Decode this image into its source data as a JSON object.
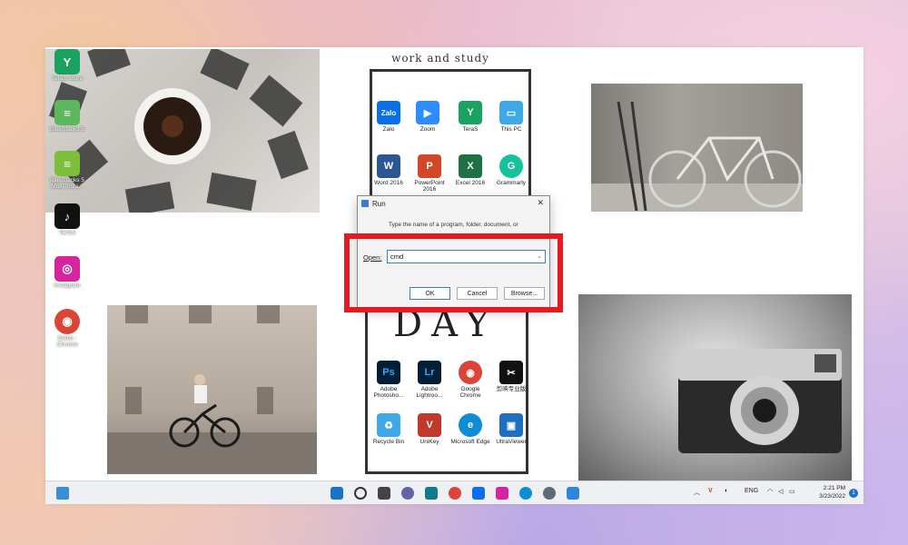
{
  "board": {
    "title": "work and study",
    "big_word": "DAY",
    "top_apps": [
      {
        "label": "Zalo",
        "icon": "zalo-icon",
        "color": "#0a6fe8",
        "glyph": "Zalo"
      },
      {
        "label": "Zoom",
        "icon": "zoom-icon",
        "color": "#2d8cff",
        "glyph": "▶"
      },
      {
        "label": "TeraS",
        "icon": "teras-icon",
        "color": "#1aa260",
        "glyph": "Y"
      },
      {
        "label": "This PC",
        "icon": "this-pc-icon",
        "color": "#3fa9e8",
        "glyph": "▭"
      },
      {
        "label": "Word 2016",
        "icon": "word-icon",
        "color": "#2b5797",
        "glyph": "W"
      },
      {
        "label": "PowerPoint 2016",
        "icon": "powerpoint-icon",
        "color": "#d24726",
        "glyph": "P"
      },
      {
        "label": "Excel 2016",
        "icon": "excel-icon",
        "color": "#1e7145",
        "glyph": "X"
      },
      {
        "label": "Grammarly",
        "icon": "grammarly-icon",
        "color": "#15c39a",
        "glyph": "G"
      }
    ],
    "bottom_apps": [
      {
        "label": "Adobe Photosho...",
        "icon": "photoshop-icon",
        "color": "#001e36",
        "glyph": "Ps"
      },
      {
        "label": "Adobe Lightroo...",
        "icon": "lightroom-icon",
        "color": "#001e36",
        "glyph": "Lr"
      },
      {
        "label": "Google Chrome",
        "icon": "chrome-icon",
        "color": "#db4437",
        "glyph": "◉"
      },
      {
        "label": "剪映专业版",
        "icon": "capcut-icon",
        "color": "#111111",
        "glyph": "✂"
      },
      {
        "label": "Recycle Bin",
        "icon": "recycle-bin-icon",
        "color": "#3fa9e8",
        "glyph": "♻"
      },
      {
        "label": "UniKey",
        "icon": "unikey-icon",
        "color": "#c0392b",
        "glyph": "V"
      },
      {
        "label": "Microsoft Edge",
        "icon": "edge-icon",
        "color": "#0c8dd6",
        "glyph": "e"
      },
      {
        "label": "UltraViewer",
        "icon": "ultraviewer-icon",
        "color": "#1f6fbf",
        "glyph": "▣"
      }
    ]
  },
  "desktop_icons": [
    {
      "label": "TeraS Store",
      "icon": "teras-store-icon",
      "color": "#1aa260",
      "glyph": "Y"
    },
    {
      "label": "BlueStacks 5",
      "icon": "bluestacks-icon",
      "color": "#5cb85c",
      "glyph": "≡"
    },
    {
      "label": "BlueStacks 5 Multi-Insta...",
      "icon": "bluestacks-multi-icon",
      "color": "#7cbf3a",
      "glyph": "≡"
    },
    {
      "label": "TikTok",
      "icon": "tiktok-icon",
      "color": "#111111",
      "glyph": "♪"
    },
    {
      "label": "Instagram",
      "icon": "instagram-icon",
      "color": "#d6249f",
      "glyph": "◎"
    },
    {
      "label": "Sarbo - Chrome",
      "icon": "chrome-profile-icon",
      "color": "#db4437",
      "glyph": "◉"
    }
  ],
  "run_dialog": {
    "title": "Run",
    "description": "Type the name of a program, folder, document, or",
    "open_label": "Open:",
    "input_value": "cmd",
    "ok_label": "OK",
    "cancel_label": "Cancel",
    "browse_label": "Browse..."
  },
  "taskbar": {
    "language": "ENG",
    "time": "2:21 PM",
    "date": "3/23/2022",
    "notification_count": "1",
    "pinned": [
      {
        "icon": "start-icon",
        "color": "#1a73c9"
      },
      {
        "icon": "search-icon",
        "color": "#333333"
      },
      {
        "icon": "task-view-icon",
        "color": "#444444"
      },
      {
        "icon": "chat-icon",
        "color": "#6264a7"
      },
      {
        "icon": "store-icon",
        "color": "#117a8b"
      },
      {
        "icon": "chrome-icon",
        "color": "#db4437"
      },
      {
        "icon": "zalo-icon",
        "color": "#0a6fe8"
      },
      {
        "icon": "instagram-icon",
        "color": "#d6249f"
      },
      {
        "icon": "edge-icon",
        "color": "#0c8dd6"
      },
      {
        "icon": "settings-icon",
        "color": "#5d6b7a"
      },
      {
        "icon": "keyboard-icon",
        "color": "#2b88d8"
      }
    ]
  }
}
